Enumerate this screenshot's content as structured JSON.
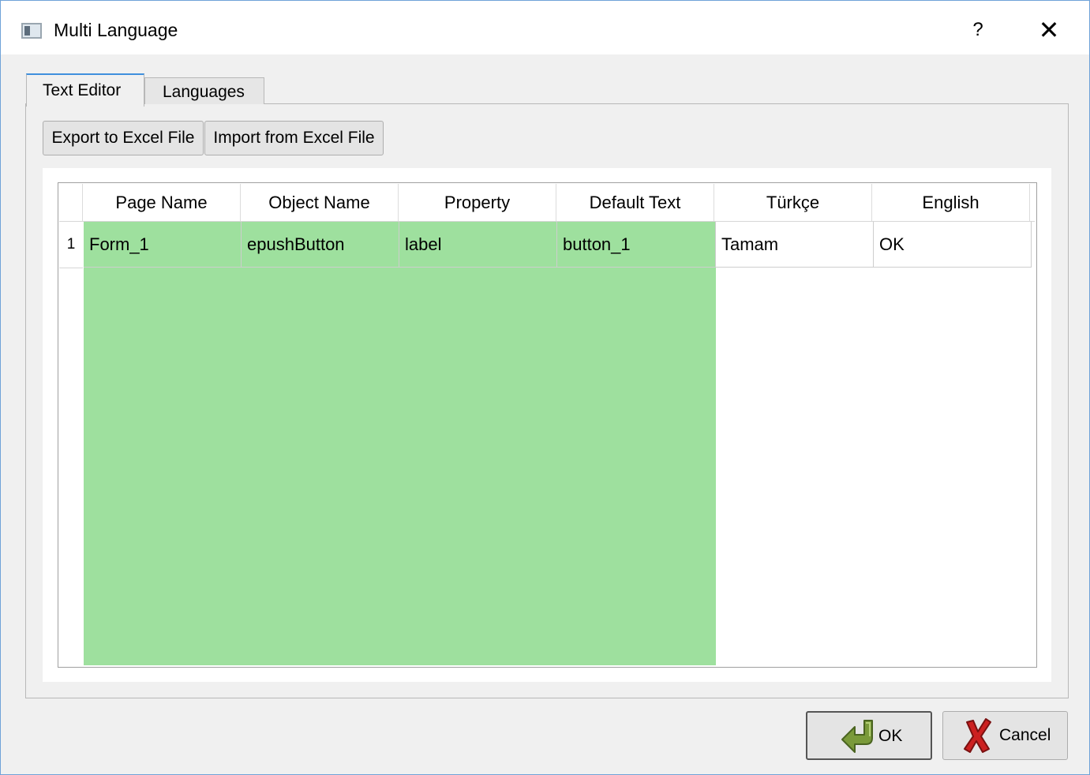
{
  "window": {
    "title": "Multi Language",
    "help_label": "?",
    "close_label": "✕",
    "app_icon": "window-icon"
  },
  "tabs": [
    {
      "label": "Text Editor",
      "active": true
    },
    {
      "label": "Languages",
      "active": false
    }
  ],
  "toolbar": {
    "export_label": "Export to Excel File",
    "import_label": "Import from Excel File"
  },
  "table": {
    "columns": [
      "Page Name",
      "Object Name",
      "Property",
      "Default Text",
      "Türkçe",
      "English"
    ],
    "rows": [
      {
        "row_number": "1",
        "cells": [
          "Form_1",
          "epushButton",
          "label",
          "button_1",
          "Tamam",
          "OK"
        ]
      }
    ],
    "readonly_column_color": "#9ee09e"
  },
  "buttons": {
    "ok_label": "OK",
    "ok_icon": "green-arrow-icon",
    "cancel_label": "Cancel",
    "cancel_icon": "red-x-icon"
  }
}
